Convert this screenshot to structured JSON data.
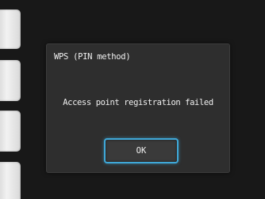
{
  "dialog": {
    "title": "WPS (PIN method)",
    "message": "Access point registration failed",
    "ok_label": "OK"
  },
  "colors": {
    "background": "#181818",
    "dialog_background": "#2e2e2e",
    "focus_accent": "#3fa8d8",
    "text": "#f0f0f0"
  }
}
